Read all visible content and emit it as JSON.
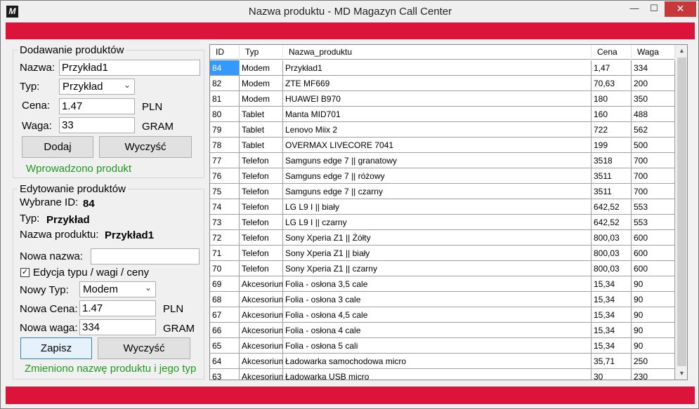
{
  "window": {
    "title": "Nazwa produktu - MD Magazyn Call Center",
    "icon_letter": "M",
    "minimize_glyph": "—",
    "maximize_glyph": "☐",
    "close_glyph": "✕"
  },
  "colors": {
    "accent": "#dc143c",
    "success_text": "#1f9a1f",
    "selection": "#3399ff"
  },
  "add_panel": {
    "title": "Dodawanie produktów",
    "name_label": "Nazwa:",
    "name_value": "Przykład1",
    "type_label": "Typ:",
    "type_value": "Przykład",
    "price_label": "Cena:",
    "price_value": "1.47",
    "price_unit": "PLN",
    "weight_label": "Waga:",
    "weight_value": "33",
    "weight_unit": "GRAM",
    "add_button": "Dodaj",
    "clear_button": "Wyczyść",
    "status": "Wprowadzono produkt"
  },
  "edit_panel": {
    "title": "Edytowanie produktów",
    "selected_id_label": "Wybrane ID:",
    "selected_id_value": "84",
    "type_label": "Typ:",
    "type_value": "Przykład",
    "product_name_label": "Nazwa produktu:",
    "product_name_value": "Przykład1",
    "new_name_label": "Nowa nazwa:",
    "new_name_value": "",
    "edit_checkbox_label": "Edycja typu / wagi / ceny",
    "edit_checkbox_mark": "✓",
    "new_type_label": "Nowy Typ:",
    "new_type_value": "Modem",
    "new_price_label": "Nowa Cena:",
    "new_price_value": "1.47",
    "new_price_unit": "PLN",
    "new_weight_label": "Nowa waga:",
    "new_weight_value": "334",
    "new_weight_unit": "GRAM",
    "save_button": "Zapisz",
    "clear_button": "Wyczyść",
    "status": "Zmieniono nazwę produktu i jego typ"
  },
  "table": {
    "columns": [
      "ID",
      "Typ",
      "Nazwa_produktu",
      "Cena",
      "Waga"
    ],
    "rows": [
      [
        "84",
        "Modem",
        "Przykład1",
        "1,47",
        "334"
      ],
      [
        "82",
        "Modem",
        "ZTE MF669",
        "70,63",
        "200"
      ],
      [
        "81",
        "Modem",
        "HUAWEI B970",
        "180",
        "350"
      ],
      [
        "80",
        "Tablet",
        "Manta MID701",
        "160",
        "488"
      ],
      [
        "79",
        "Tablet",
        "Lenovo Miix 2",
        "722",
        "562"
      ],
      [
        "78",
        "Tablet",
        "OVERMAX LIVECORE 7041",
        "199",
        "500"
      ],
      [
        "77",
        "Telefon",
        "Samguns edge 7 || granatowy",
        "3518",
        "700"
      ],
      [
        "76",
        "Telefon",
        "Samguns edge 7 || różowy",
        "3511",
        "700"
      ],
      [
        "75",
        "Telefon",
        "Samguns edge 7 || czarny",
        "3511",
        "700"
      ],
      [
        "74",
        "Telefon",
        "LG L9 I || biały",
        "642,52",
        "553"
      ],
      [
        "73",
        "Telefon",
        "LG L9 I || czarny",
        "642,52",
        "553"
      ],
      [
        "72",
        "Telefon",
        "Sony Xperia Z1 || Żółty",
        "800,03",
        "600"
      ],
      [
        "71",
        "Telefon",
        "Sony Xperia Z1 || biały",
        "800,03",
        "600"
      ],
      [
        "70",
        "Telefon",
        "Sony Xperia Z1 || czarny",
        "800,03",
        "600"
      ],
      [
        "69",
        "Akcesorium",
        "Folia - osłona 3,5 cale",
        "15,34",
        "90"
      ],
      [
        "68",
        "Akcesorium",
        "Folia - osłona 3 cale",
        "15,34",
        "90"
      ],
      [
        "67",
        "Akcesorium",
        "Folia - osłona 4,5 cale",
        "15,34",
        "90"
      ],
      [
        "66",
        "Akcesorium",
        "Folia - osłona 4 cale",
        "15,34",
        "90"
      ],
      [
        "65",
        "Akcesorium",
        "Folia - osłona 5 cali",
        "15,34",
        "90"
      ],
      [
        "64",
        "Akcesorium",
        "Ładowarka samochodowa micro",
        "35,71",
        "250"
      ],
      [
        "63",
        "Akcesorium",
        "Ładowarka USB micro",
        "30",
        "230"
      ]
    ],
    "selected_row": 0
  }
}
